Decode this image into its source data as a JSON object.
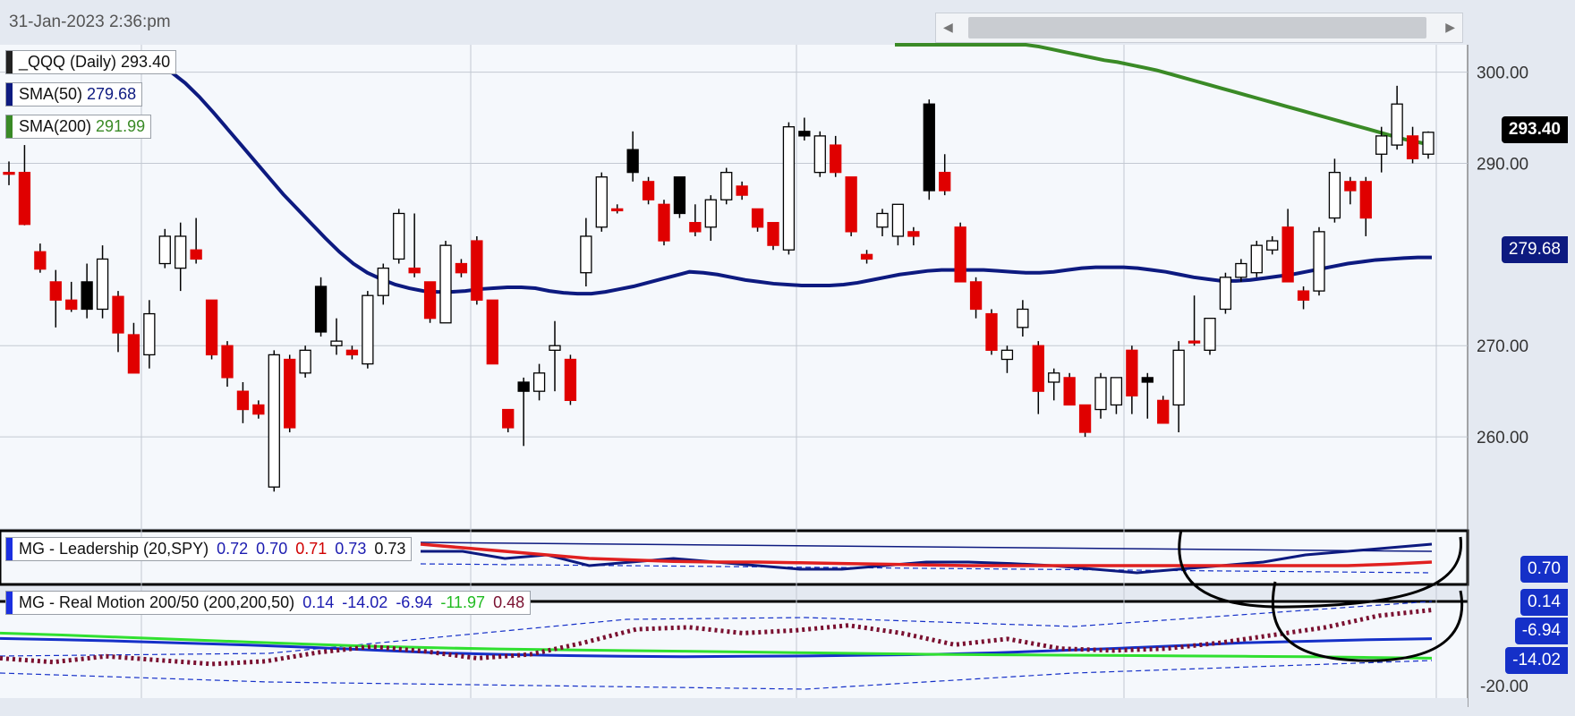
{
  "header": {
    "timestamp": "31-Jan-2023 2:36:pm"
  },
  "scrollbar": {
    "left_arrow": "◀",
    "right_arrow": "▶"
  },
  "legends": {
    "price": {
      "label": "_QQQ (Daily)",
      "value": "293.40",
      "chip_color": "#222222",
      "value_color": "#111111"
    },
    "sma50": {
      "label": "SMA(50)",
      "value": "279.68",
      "chip_color": "#0d1a80",
      "value_color": "#0d1a80"
    },
    "sma200": {
      "label": "SMA(200)",
      "value": "291.99",
      "chip_color": "#3a8a26",
      "value_color": "#3a8a26"
    },
    "leadership": {
      "label": "MG - Leadership (20,SPY)",
      "chip_color": "#1b2fe0",
      "values": [
        {
          "text": "0.72",
          "color": "#1c1cb0"
        },
        {
          "text": "0.70",
          "color": "#1c1cb0"
        },
        {
          "text": "0.71",
          "color": "#d00000"
        },
        {
          "text": "0.73",
          "color": "#1c1cb0"
        },
        {
          "text": "0.73",
          "color": "#111111"
        }
      ]
    },
    "realmotion": {
      "label": "MG - Real Motion 200/50 (200,200,50)",
      "chip_color": "#1b2fe0",
      "values": [
        {
          "text": "0.14",
          "color": "#1c1cb0"
        },
        {
          "text": "-14.02",
          "color": "#1c1cb0"
        },
        {
          "text": "-6.94",
          "color": "#1c1cb0"
        },
        {
          "text": "-11.97",
          "color": "#22bb22"
        },
        {
          "text": "0.48",
          "color": "#7a1030"
        }
      ]
    }
  },
  "price_tags": {
    "last": {
      "text": "293.40",
      "bg": "#000000"
    },
    "sma50": {
      "text": "279.68",
      "bg": "#0d1a80"
    },
    "leadership": {
      "text": "0.70",
      "bg": "#1530c8"
    },
    "rm1": {
      "text": "0.14",
      "bg": "#1530c8"
    },
    "rm2": {
      "text": "-6.94",
      "bg": "#1530c8"
    },
    "rm3": {
      "text": "-14.02",
      "bg": "#1530c8"
    }
  },
  "y_axis": {
    "ticks": [
      "300.00",
      "290.00",
      "270.00",
      "260.00"
    ],
    "rm_tick": "-20.00"
  },
  "colors": {
    "up_candle": "#ffffff",
    "down_candle_red": "#e00000",
    "down_candle_black": "#000000",
    "sma50": "#0d1a80",
    "sma200": "#3a8a26",
    "leadership_blue": "#0d1a80",
    "leadership_red": "#e02020",
    "rm_blue": "#1530c8",
    "rm_green": "#30e030",
    "rm_dotted": "#7a1030"
  },
  "chart_data": {
    "type": "candlestick",
    "symbol": "_QQQ (Daily)",
    "ylim": [
      250,
      303
    ],
    "yticks": [
      260,
      270,
      290,
      300
    ],
    "candles": [
      {
        "o": 288.8,
        "h": 290.2,
        "l": 287.6,
        "c": 289.0,
        "color": "red"
      },
      {
        "o": 289.0,
        "h": 292.0,
        "l": 283.2,
        "c": 283.3,
        "color": "red"
      },
      {
        "o": 280.3,
        "h": 281.2,
        "l": 278.0,
        "c": 278.4,
        "color": "red"
      },
      {
        "o": 277.0,
        "h": 278.3,
        "l": 272.0,
        "c": 275.0,
        "color": "red"
      },
      {
        "o": 275.0,
        "h": 277.0,
        "l": 273.7,
        "c": 274.0,
        "color": "red"
      },
      {
        "o": 277.0,
        "h": 279.0,
        "l": 273.0,
        "c": 274.0,
        "color": "black"
      },
      {
        "o": 274.0,
        "h": 281.0,
        "l": 273.0,
        "c": 279.5,
        "color": "white"
      },
      {
        "o": 275.4,
        "h": 276.0,
        "l": 269.3,
        "c": 271.4,
        "color": "red"
      },
      {
        "o": 271.2,
        "h": 272.5,
        "l": 267.0,
        "c": 267.0,
        "color": "red"
      },
      {
        "o": 269.0,
        "h": 275.0,
        "l": 267.5,
        "c": 273.5,
        "color": "white"
      },
      {
        "o": 279.0,
        "h": 282.8,
        "l": 278.5,
        "c": 282.0,
        "color": "white"
      },
      {
        "o": 282.0,
        "h": 283.5,
        "l": 276.0,
        "c": 278.5,
        "color": "white"
      },
      {
        "o": 280.5,
        "h": 284.0,
        "l": 279.0,
        "c": 279.5,
        "color": "red"
      },
      {
        "o": 275.0,
        "h": 275.0,
        "l": 268.5,
        "c": 269.0,
        "color": "red"
      },
      {
        "o": 270.0,
        "h": 270.5,
        "l": 265.5,
        "c": 266.5,
        "color": "red"
      },
      {
        "o": 265.0,
        "h": 266.0,
        "l": 261.5,
        "c": 263.0,
        "color": "red"
      },
      {
        "o": 263.5,
        "h": 264.0,
        "l": 262.0,
        "c": 262.5,
        "color": "red"
      },
      {
        "o": 254.5,
        "h": 269.5,
        "l": 254.0,
        "c": 269.0,
        "color": "white"
      },
      {
        "o": 268.5,
        "h": 269.0,
        "l": 260.5,
        "c": 261.0,
        "color": "red"
      },
      {
        "o": 267.0,
        "h": 270.0,
        "l": 266.5,
        "c": 269.5,
        "color": "white"
      },
      {
        "o": 276.5,
        "h": 277.5,
        "l": 271.0,
        "c": 271.5,
        "color": "black"
      },
      {
        "o": 270.5,
        "h": 273.0,
        "l": 269.0,
        "c": 270.0,
        "color": "white"
      },
      {
        "o": 269.5,
        "h": 270.0,
        "l": 268.5,
        "c": 269.0,
        "color": "red"
      },
      {
        "o": 268.0,
        "h": 276.0,
        "l": 267.5,
        "c": 275.5,
        "color": "white"
      },
      {
        "o": 275.5,
        "h": 279.0,
        "l": 274.5,
        "c": 278.5,
        "color": "white"
      },
      {
        "o": 279.5,
        "h": 285.0,
        "l": 279.0,
        "c": 284.5,
        "color": "white"
      },
      {
        "o": 278.5,
        "h": 284.5,
        "l": 277.5,
        "c": 278.0,
        "color": "red"
      },
      {
        "o": 277.0,
        "h": 277.0,
        "l": 272.5,
        "c": 273.0,
        "color": "red"
      },
      {
        "o": 272.5,
        "h": 281.5,
        "l": 272.5,
        "c": 281.0,
        "color": "white"
      },
      {
        "o": 279.0,
        "h": 279.5,
        "l": 277.5,
        "c": 278.0,
        "color": "red"
      },
      {
        "o": 281.5,
        "h": 282.0,
        "l": 274.5,
        "c": 275.0,
        "color": "red"
      },
      {
        "o": 275.0,
        "h": 275.0,
        "l": 268.0,
        "c": 268.0,
        "color": "red"
      },
      {
        "o": 263.0,
        "h": 263.0,
        "l": 260.5,
        "c": 261.0,
        "color": "red"
      },
      {
        "o": 265.0,
        "h": 266.5,
        "l": 259.0,
        "c": 266.0,
        "color": "black"
      },
      {
        "o": 265.0,
        "h": 268.0,
        "l": 264.0,
        "c": 267.0,
        "color": "white"
      },
      {
        "o": 269.5,
        "h": 272.7,
        "l": 265.0,
        "c": 270.0,
        "color": "white"
      },
      {
        "o": 268.5,
        "h": 269.0,
        "l": 263.5,
        "c": 264.0,
        "color": "red"
      },
      {
        "o": 278.0,
        "h": 284.0,
        "l": 276.5,
        "c": 282.0,
        "color": "white"
      },
      {
        "o": 283.0,
        "h": 289.0,
        "l": 282.5,
        "c": 288.5,
        "color": "white"
      },
      {
        "o": 285.0,
        "h": 285.5,
        "l": 284.5,
        "c": 284.8,
        "color": "red"
      },
      {
        "o": 291.5,
        "h": 293.5,
        "l": 288.0,
        "c": 289.0,
        "color": "black"
      },
      {
        "o": 288.0,
        "h": 288.5,
        "l": 285.5,
        "c": 286.0,
        "color": "red"
      },
      {
        "o": 285.5,
        "h": 286.0,
        "l": 281.0,
        "c": 281.5,
        "color": "red"
      },
      {
        "o": 288.5,
        "h": 288.5,
        "l": 284.0,
        "c": 284.5,
        "color": "black"
      },
      {
        "o": 283.5,
        "h": 285.5,
        "l": 282.0,
        "c": 282.5,
        "color": "red"
      },
      {
        "o": 283.0,
        "h": 286.5,
        "l": 281.5,
        "c": 286.0,
        "color": "white"
      },
      {
        "o": 286.0,
        "h": 289.5,
        "l": 285.5,
        "c": 289.0,
        "color": "white"
      },
      {
        "o": 287.5,
        "h": 288.0,
        "l": 286.0,
        "c": 286.5,
        "color": "red"
      },
      {
        "o": 285.0,
        "h": 285.0,
        "l": 282.5,
        "c": 283.0,
        "color": "red"
      },
      {
        "o": 283.5,
        "h": 283.5,
        "l": 280.5,
        "c": 281.0,
        "color": "red"
      },
      {
        "o": 280.5,
        "h": 294.5,
        "l": 280.0,
        "c": 294.0,
        "color": "white"
      },
      {
        "o": 293.0,
        "h": 295.0,
        "l": 292.5,
        "c": 293.5,
        "color": "black"
      },
      {
        "o": 293.0,
        "h": 293.5,
        "l": 288.5,
        "c": 289.0,
        "color": "white"
      },
      {
        "o": 292.0,
        "h": 293.0,
        "l": 288.5,
        "c": 289.0,
        "color": "red"
      },
      {
        "o": 288.5,
        "h": 288.5,
        "l": 282.0,
        "c": 282.5,
        "color": "red"
      },
      {
        "o": 280.0,
        "h": 280.5,
        "l": 279.0,
        "c": 279.5,
        "color": "red"
      },
      {
        "o": 283.0,
        "h": 285.0,
        "l": 282.0,
        "c": 284.5,
        "color": "white"
      },
      {
        "o": 282.0,
        "h": 285.5,
        "l": 281.0,
        "c": 285.5,
        "color": "white"
      },
      {
        "o": 282.0,
        "h": 283.0,
        "l": 281.0,
        "c": 282.5,
        "color": "red"
      },
      {
        "o": 296.5,
        "h": 297.0,
        "l": 286.0,
        "c": 287.0,
        "color": "black"
      },
      {
        "o": 289.0,
        "h": 291.0,
        "l": 286.5,
        "c": 287.0,
        "color": "red"
      },
      {
        "o": 283.0,
        "h": 283.5,
        "l": 277.0,
        "c": 277.0,
        "color": "red"
      },
      {
        "o": 277.0,
        "h": 277.5,
        "l": 273.0,
        "c": 274.0,
        "color": "red"
      },
      {
        "o": 273.5,
        "h": 274.0,
        "l": 269.0,
        "c": 269.5,
        "color": "red"
      },
      {
        "o": 269.5,
        "h": 270.0,
        "l": 267.0,
        "c": 268.5,
        "color": "white"
      },
      {
        "o": 272.0,
        "h": 275.0,
        "l": 271.0,
        "c": 274.0,
        "color": "white"
      },
      {
        "o": 270.0,
        "h": 270.5,
        "l": 262.5,
        "c": 265.0,
        "color": "red"
      },
      {
        "o": 266.0,
        "h": 267.5,
        "l": 264.0,
        "c": 267.0,
        "color": "white"
      },
      {
        "o": 266.5,
        "h": 267.0,
        "l": 263.5,
        "c": 263.5,
        "color": "red"
      },
      {
        "o": 263.5,
        "h": 263.5,
        "l": 260.0,
        "c": 260.5,
        "color": "red"
      },
      {
        "o": 263.0,
        "h": 267.0,
        "l": 262.0,
        "c": 266.5,
        "color": "white"
      },
      {
        "o": 263.5,
        "h": 264.5,
        "l": 262.5,
        "c": 266.5,
        "color": "white"
      },
      {
        "o": 269.5,
        "h": 270.0,
        "l": 262.5,
        "c": 264.5,
        "color": "red"
      },
      {
        "o": 266.0,
        "h": 267.0,
        "l": 262.0,
        "c": 266.5,
        "color": "black"
      },
      {
        "o": 264.0,
        "h": 264.5,
        "l": 261.5,
        "c": 261.5,
        "color": "red"
      },
      {
        "o": 263.5,
        "h": 270.5,
        "l": 260.5,
        "c": 269.5,
        "color": "white"
      },
      {
        "o": 270.5,
        "h": 275.5,
        "l": 270.0,
        "c": 270.5,
        "color": "red"
      },
      {
        "o": 269.5,
        "h": 273.0,
        "l": 269.0,
        "c": 273.0,
        "color": "white"
      },
      {
        "o": 274.0,
        "h": 278.0,
        "l": 273.5,
        "c": 277.5,
        "color": "white"
      },
      {
        "o": 277.5,
        "h": 279.5,
        "l": 277.0,
        "c": 279.0,
        "color": "white"
      },
      {
        "o": 278.0,
        "h": 281.5,
        "l": 277.5,
        "c": 281.0,
        "color": "white"
      },
      {
        "o": 280.5,
        "h": 282.0,
        "l": 280.0,
        "c": 281.5,
        "color": "white"
      },
      {
        "o": 283.0,
        "h": 285.0,
        "l": 277.0,
        "c": 277.0,
        "color": "red"
      },
      {
        "o": 276.0,
        "h": 276.5,
        "l": 274.0,
        "c": 275.0,
        "color": "red"
      },
      {
        "o": 276.0,
        "h": 283.0,
        "l": 275.5,
        "c": 282.5,
        "color": "white"
      },
      {
        "o": 284.0,
        "h": 290.5,
        "l": 283.5,
        "c": 289.0,
        "color": "white"
      },
      {
        "o": 287.0,
        "h": 288.5,
        "l": 285.5,
        "c": 288.0,
        "color": "red"
      },
      {
        "o": 288.0,
        "h": 288.5,
        "l": 282.0,
        "c": 284.0,
        "color": "red"
      },
      {
        "o": 291.0,
        "h": 294.0,
        "l": 289.0,
        "c": 293.0,
        "color": "white"
      },
      {
        "o": 292.0,
        "h": 298.5,
        "l": 291.5,
        "c": 296.5,
        "color": "white"
      },
      {
        "o": 293.0,
        "h": 294.0,
        "l": 290.0,
        "c": 290.5,
        "color": "red"
      },
      {
        "o": 291.0,
        "h": 293.5,
        "l": 290.5,
        "c": 293.4,
        "color": "white"
      }
    ],
    "sma50": [
      301.5,
      301.0,
      300.0,
      298.8,
      297.3,
      295.6,
      293.8,
      292.0,
      290.2,
      288.4,
      286.6,
      285.0,
      283.4,
      281.8,
      280.3,
      279.0,
      278.0,
      277.3,
      276.7,
      276.3,
      276.0,
      275.9,
      275.9,
      276.0,
      276.2,
      276.3,
      276.4,
      276.4,
      276.3,
      276.0,
      275.8,
      275.7,
      275.7,
      275.9,
      276.2,
      276.5,
      276.9,
      277.3,
      277.7,
      278.1,
      278.0,
      277.8,
      277.5,
      277.2,
      277.0,
      276.8,
      276.7,
      276.6,
      276.6,
      276.6,
      276.7,
      276.9,
      277.2,
      277.5,
      277.8,
      278.0,
      278.2,
      278.3,
      278.3,
      278.3,
      278.3,
      278.2,
      278.1,
      278.0,
      278.0,
      278.1,
      278.3,
      278.5,
      278.6,
      278.6,
      278.6,
      278.5,
      278.3,
      278.1,
      277.8,
      277.5,
      277.3,
      277.1,
      277.1,
      277.2,
      277.4,
      277.6,
      277.8,
      278.1,
      278.4,
      278.7,
      279.0,
      279.2,
      279.4,
      279.5,
      279.6,
      279.68,
      279.68
    ],
    "sma200": [
      307.0,
      306.5,
      306.0,
      305.6,
      305.2,
      304.8,
      304.4,
      304.1,
      303.8,
      303.5,
      303.2,
      302.8,
      302.5,
      302.2,
      301.9,
      301.6,
      301.3,
      301.1,
      300.8,
      300.5,
      300.2,
      299.8,
      299.4,
      299.0,
      298.6,
      298.2,
      297.8,
      297.4,
      297.0,
      296.6,
      296.2,
      295.8,
      295.4,
      295.0,
      294.6,
      294.2,
      293.8,
      293.4,
      293.0,
      292.6,
      292.3,
      291.99
    ],
    "leadership": {
      "series": [
        {
          "name": "blue",
          "values": [
            0.72,
            0.72,
            0.71,
            0.715,
            0.7,
            0.705,
            0.71,
            0.705,
            0.7,
            0.695,
            0.695,
            0.7,
            0.705,
            0.705,
            0.703,
            0.7,
            0.695,
            0.69,
            0.695,
            0.7,
            0.705,
            0.715,
            0.72,
            0.725,
            0.73
          ]
        },
        {
          "name": "red",
          "values": [
            0.73,
            0.725,
            0.72,
            0.715,
            0.71,
            0.708,
            0.706,
            0.705,
            0.705,
            0.704,
            0.703,
            0.702,
            0.701,
            0.7,
            0.7,
            0.7,
            0.7,
            0.7,
            0.7,
            0.7,
            0.7,
            0.7,
            0.7,
            0.702,
            0.705
          ]
        }
      ]
    },
    "real_motion": {
      "series": [
        {
          "name": "blue",
          "values": [
            -6.9,
            -7.2,
            -7.6,
            -8.1,
            -8.6,
            -9.2,
            -9.9,
            -10.6,
            -11.0,
            -11.3,
            -11.5,
            -11.6,
            -11.5,
            -11.4,
            -11.2,
            -11.0,
            -10.6,
            -10.0,
            -9.4,
            -8.7,
            -8.0,
            -7.6,
            -7.2,
            -6.94
          ]
        },
        {
          "name": "green",
          "values": [
            -5.5,
            -6.0,
            -6.6,
            -7.2,
            -7.8,
            -8.4,
            -8.9,
            -9.3,
            -9.6,
            -9.8,
            -10.0,
            -10.2,
            -10.4,
            -10.6,
            -10.8,
            -11.0,
            -11.1,
            -11.2,
            -11.3,
            -11.4,
            -11.5,
            -11.6,
            -11.8,
            -11.97
          ]
        },
        {
          "name": "dotted",
          "values": [
            -12.0,
            -13.0,
            -11.5,
            -12.5,
            -13.5,
            -12.8,
            -10.5,
            -9.0,
            -10.2,
            -12.0,
            -11.0,
            -8.0,
            -4.5,
            -4.0,
            -5.5,
            -4.8,
            -3.5,
            -5.5,
            -8.5,
            -7.0,
            -9.5,
            -10.0,
            -9.5,
            -8.0,
            -6.0,
            -4.0,
            -1.0,
            0.48
          ]
        }
      ]
    }
  }
}
